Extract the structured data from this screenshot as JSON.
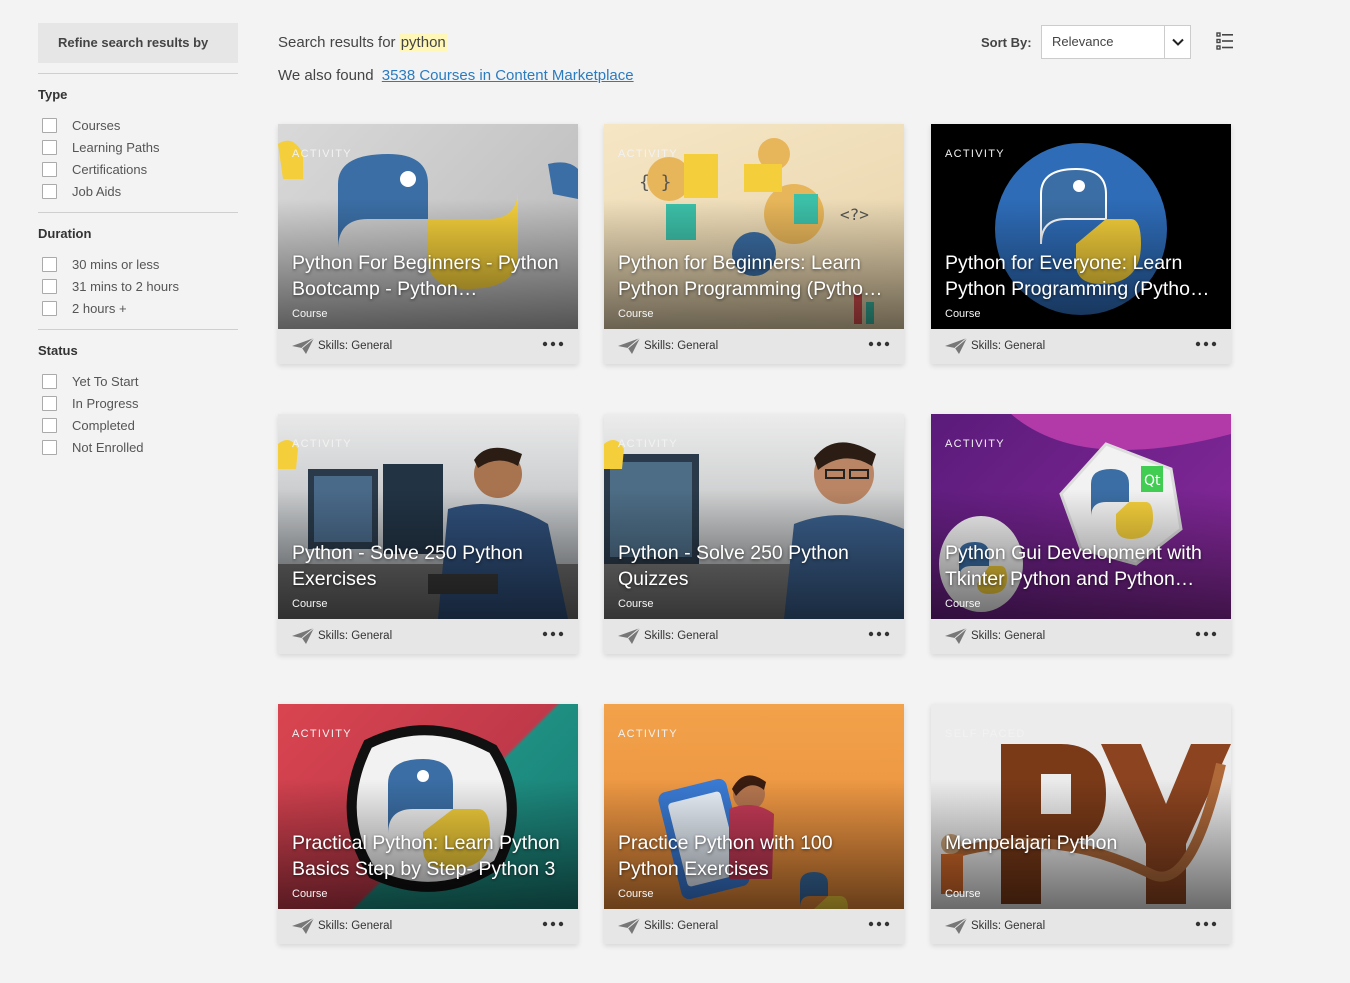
{
  "sidebar": {
    "refine_label": "Refine search results by",
    "groups": [
      {
        "title": "Type",
        "options": [
          "Courses",
          "Learning Paths",
          "Certifications",
          "Job Aids"
        ]
      },
      {
        "title": "Duration",
        "options": [
          "30 mins or less",
          "31 mins to 2 hours",
          "2 hours +"
        ]
      },
      {
        "title": "Status",
        "options": [
          "Yet To Start",
          "In Progress",
          "Completed",
          "Not Enrolled"
        ]
      }
    ]
  },
  "header": {
    "search_prefix": "Search results for",
    "search_term": "python",
    "found_prefix": "We also found",
    "found_link": "3538 Courses in Content Marketplace",
    "sort_label": "Sort By:",
    "sort_value": "Relevance"
  },
  "colors": {
    "link": "#2a7bc0",
    "highlight": "#fff7b8",
    "python_blue": "#3b6ea5",
    "python_yellow": "#f4cf3b"
  },
  "cards": [
    {
      "kind": "ACTIVITY",
      "title": "Python For Beginners - Python Bootcamp - Python…",
      "type": "Course",
      "skills": "Skills: General"
    },
    {
      "kind": "ACTIVITY",
      "title": "Python for Beginners: Learn Python Programming (Pytho…",
      "type": "Course",
      "skills": "Skills: General"
    },
    {
      "kind": "ACTIVITY",
      "title": "Python for Everyone: Learn Python Programming (Pytho…",
      "type": "Course",
      "skills": "Skills: General"
    },
    {
      "kind": "ACTIVITY",
      "title": "Python - Solve 250 Python Exercises",
      "type": "Course",
      "skills": "Skills: General"
    },
    {
      "kind": "ACTIVITY",
      "title": "Python - Solve 250 Python Quizzes",
      "type": "Course",
      "skills": "Skills: General"
    },
    {
      "kind": "ACTIVITY",
      "title": "Python Gui Development with Tkinter Python and Python…",
      "type": "Course",
      "skills": "Skills: General"
    },
    {
      "kind": "ACTIVITY",
      "title": "Practical Python: Learn Python Basics Step by Step- Python 3",
      "type": "Course",
      "skills": "Skills: General"
    },
    {
      "kind": "ACTIVITY",
      "title": "Practice Python with 100 Python Exercises",
      "type": "Course",
      "skills": "Skills: General"
    },
    {
      "kind": "SELF PACED",
      "title": "Mempelajari Python",
      "type": "Course",
      "skills": "Skills: General"
    }
  ]
}
